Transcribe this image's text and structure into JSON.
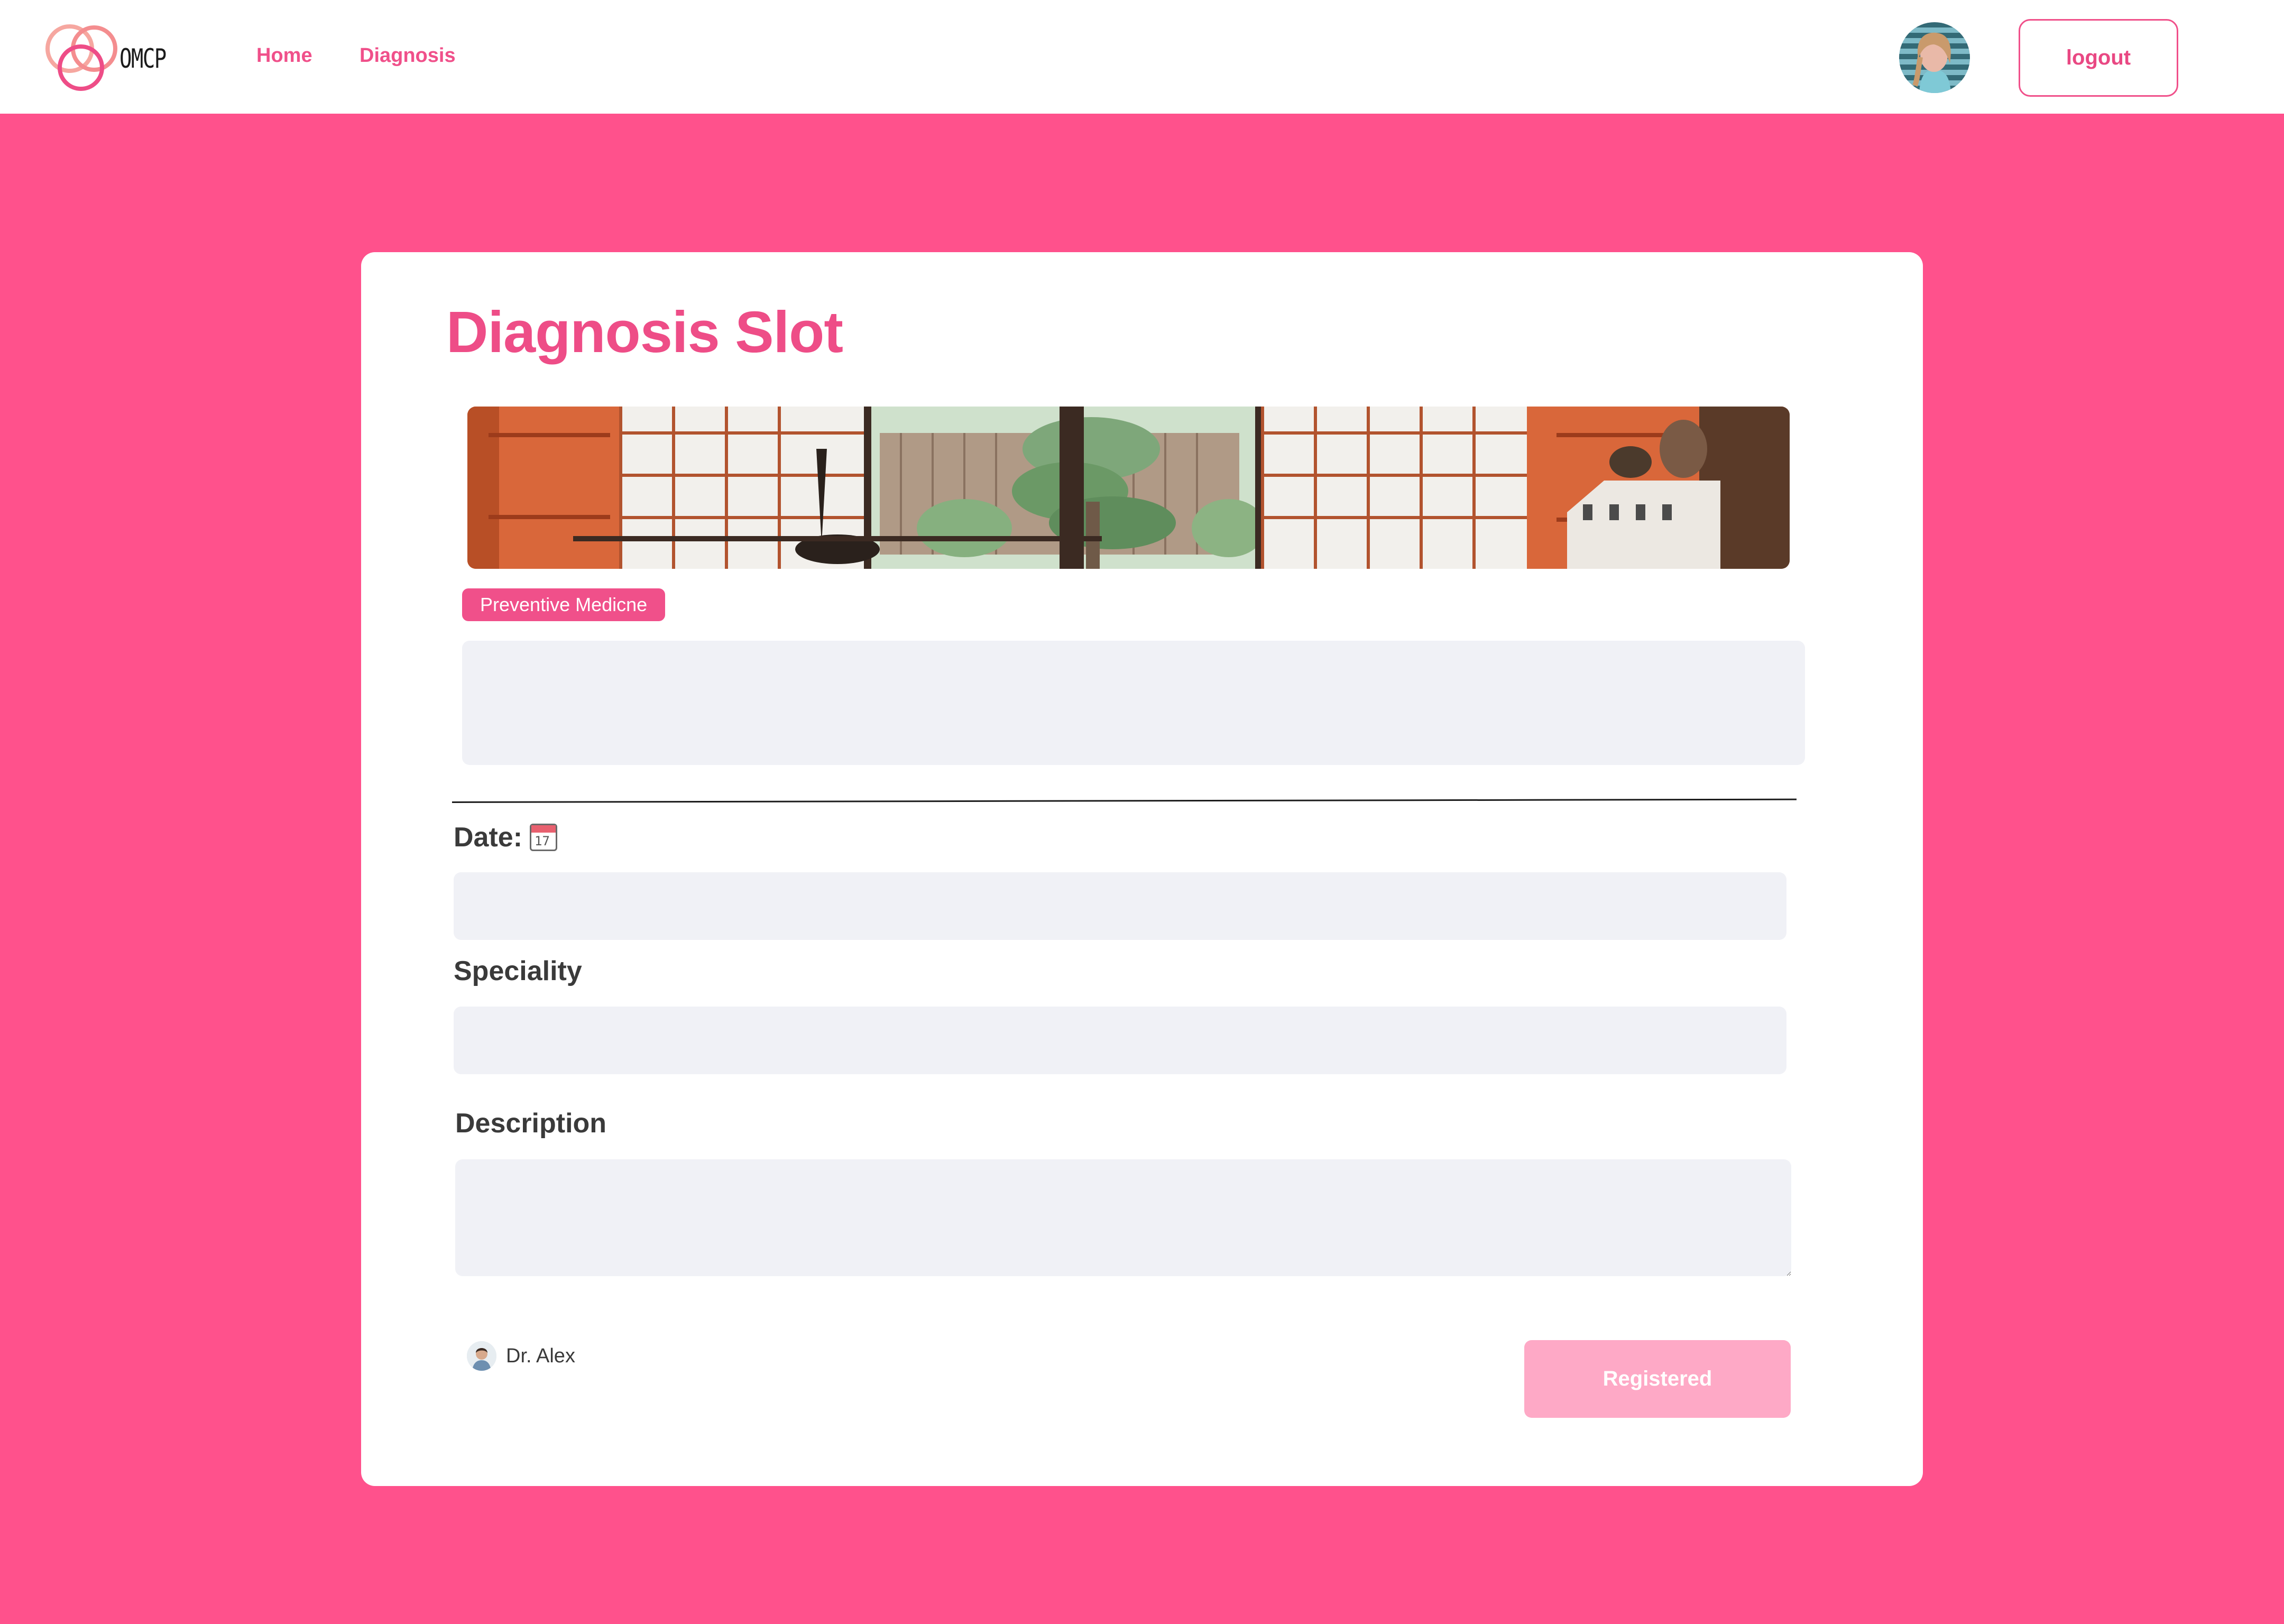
{
  "header": {
    "logo_text": "OMCP",
    "nav": [
      {
        "label": "Home"
      },
      {
        "label": "Diagnosis"
      }
    ],
    "logout_label": "logout"
  },
  "card": {
    "title": "Diagnosis Slot",
    "tag": "Preventive Medicne",
    "date_label": "Date:",
    "calendar_day": "17",
    "speciality_label": "Speciality",
    "description_label": "Description",
    "doctor_name": "Dr. Alex",
    "register_label": "Registered"
  },
  "colors": {
    "brand_pink": "#ff518c",
    "accent": "#f0508a",
    "button_disabled": "#fea9c6",
    "field_bg": "#f0f1f6"
  },
  "icons": {
    "logo": "overlapping-rings-logo",
    "calendar": "calendar-icon",
    "user_avatar": "avatar",
    "doctor_avatar": "doctor-avatar"
  }
}
